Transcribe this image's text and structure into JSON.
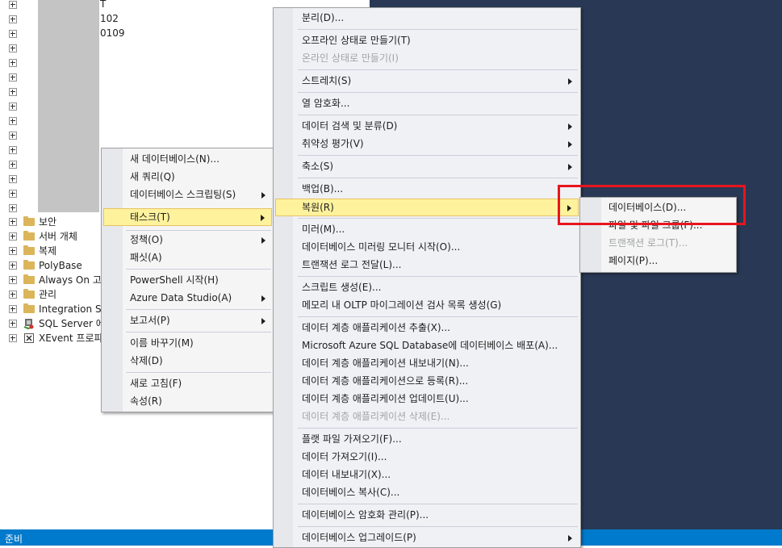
{
  "object_explorer": {
    "partial_labels": [
      "T",
      "102",
      "0109"
    ],
    "nodes": [
      {
        "label": "보안",
        "icon": "folder-icon"
      },
      {
        "label": "서버 개체",
        "icon": "folder-icon"
      },
      {
        "label": "복제",
        "icon": "folder-icon"
      },
      {
        "label": "PolyBase",
        "icon": "folder-icon"
      },
      {
        "label": "Always On 고가",
        "icon": "folder-icon"
      },
      {
        "label": "관리",
        "icon": "folder-icon"
      },
      {
        "label": "Integration Ser",
        "icon": "folder-icon"
      },
      {
        "label": "SQL Server 에",
        "icon": "sql-agent-icon"
      },
      {
        "label": "XEvent 프로파",
        "icon": "xevent-icon"
      }
    ]
  },
  "context_menu": {
    "items": [
      {
        "label": "새 데이터베이스(N)...",
        "submenu": false
      },
      {
        "label": "새 쿼리(Q)",
        "submenu": false
      },
      {
        "label": "데이터베이스 스크립팅(S)",
        "submenu": true
      },
      {
        "label": "태스크(T)",
        "submenu": true,
        "highlighted": true
      },
      {
        "label": "정책(O)",
        "submenu": true
      },
      {
        "label": "패싯(A)",
        "submenu": false
      },
      {
        "label": "PowerShell 시작(H)",
        "submenu": false
      },
      {
        "label": "Azure Data Studio(A)",
        "submenu": true
      },
      {
        "label": "보고서(P)",
        "submenu": true
      },
      {
        "label": "이름 바꾸기(M)",
        "submenu": false
      },
      {
        "label": "삭제(D)",
        "submenu": false
      },
      {
        "label": "새로 고침(F)",
        "submenu": false
      },
      {
        "label": "속성(R)",
        "submenu": false
      }
    ]
  },
  "tasks_menu": {
    "items": [
      {
        "label": "분리(D)..."
      },
      {
        "label": "오프라인 상태로 만들기(T)"
      },
      {
        "label": "온라인 상태로 만들기(I)",
        "disabled": true
      },
      {
        "label": "스트레치(S)",
        "submenu": true
      },
      {
        "label": "열 암호화..."
      },
      {
        "label": "데이터 검색 및 분류(D)",
        "submenu": true
      },
      {
        "label": "취약성 평가(V)",
        "submenu": true
      },
      {
        "label": "축소(S)",
        "submenu": true
      },
      {
        "label": "백업(B)..."
      },
      {
        "label": "복원(R)",
        "submenu": true,
        "highlighted": true
      },
      {
        "label": "미러(M)..."
      },
      {
        "label": "데이터베이스 미러링 모니터 시작(O)..."
      },
      {
        "label": "트랜잭션 로그 전달(L)..."
      },
      {
        "label": "스크립트 생성(E)..."
      },
      {
        "label": "메모리 내 OLTP 마이그레이션 검사 목록 생성(G)"
      },
      {
        "label": "데이터 계층 애플리케이션 추출(X)..."
      },
      {
        "label": "Microsoft Azure SQL Database에 데이터베이스 배포(A)..."
      },
      {
        "label": "데이터 계층 애플리케이션 내보내기(N)..."
      },
      {
        "label": "데이터 계층 애플리케이션으로 등록(R)..."
      },
      {
        "label": "데이터 계층 애플리케이션 업데이트(U)..."
      },
      {
        "label": "데이터 계층 애플리케이션 삭제(E)...",
        "disabled": true
      },
      {
        "label": "플랫 파일 가져오기(F)..."
      },
      {
        "label": "데이터 가져오기(I)..."
      },
      {
        "label": "데이터 내보내기(X)..."
      },
      {
        "label": "데이터베이스 복사(C)..."
      },
      {
        "label": "데이터베이스 암호화 관리(P)..."
      },
      {
        "label": "데이터베이스 업그레이드(P)",
        "submenu": true
      }
    ]
  },
  "restore_menu": {
    "items": [
      {
        "label": "데이터베이스(D)..."
      },
      {
        "label": "파일 및 파일 그룹(F)..."
      },
      {
        "label": "트랜잭션 로그(T)...",
        "disabled": true
      },
      {
        "label": "페이지(P)..."
      }
    ]
  },
  "status_bar": {
    "text": "준비"
  },
  "colors": {
    "status_bar": "#007acc",
    "highlight": "#fff29d",
    "annotation": "#e8151d",
    "background": "#293955"
  }
}
